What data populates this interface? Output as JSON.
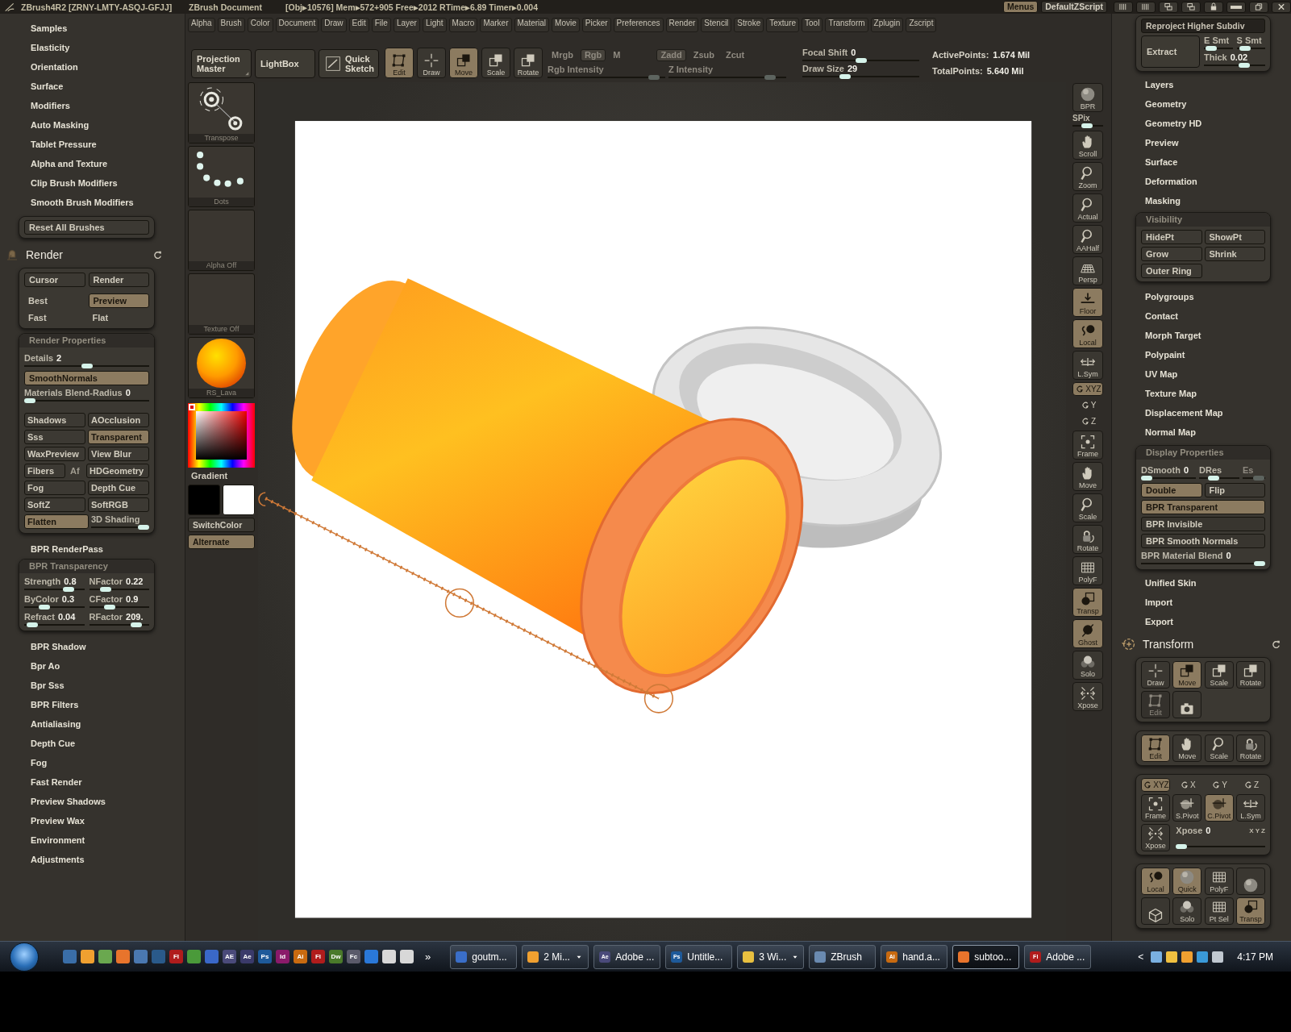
{
  "title_bar": {
    "app_title": "ZBrush4R2 [ZRNY-LMTY-ASQJ-GFJJ]",
    "document": "ZBrush Document",
    "stats": "[Obj▸10576] Mem▸572+905 Free▸2012 RTime▸6.89 Timer▸0.004",
    "buttons": [
      {
        "label": "Menus",
        "selected": true
      },
      {
        "label": "DefaultZScript",
        "selected": false
      }
    ]
  },
  "menu_bar": [
    "Alpha",
    "Brush",
    "Color",
    "Document",
    "Draw",
    "Edit",
    "File",
    "Layer",
    "Light",
    "Macro",
    "Marker",
    "Material",
    "Movie",
    "Picker",
    "Preferences",
    "Render",
    "Stencil",
    "Stroke",
    "Texture",
    "Tool",
    "Transform",
    "Zplugin",
    "Zscript"
  ],
  "top_toolbar": {
    "big_buttons": [
      "Projection Master",
      "LightBox",
      "Quick Sketch"
    ],
    "modes": [
      {
        "label": "Edit",
        "selected": true
      },
      {
        "label": "Draw",
        "selected": false
      },
      {
        "label": "Move",
        "selected": true
      },
      {
        "label": "Scale",
        "selected": false
      },
      {
        "label": "Rotate",
        "selected": false
      }
    ],
    "channels": {
      "disabled": true,
      "buttons": [
        {
          "label": "Mrgb",
          "selected": false
        },
        {
          "label": "Rgb",
          "selected": true
        },
        {
          "label": "M",
          "selected": false
        },
        {
          "label": "Zadd",
          "selected": true
        },
        {
          "label": "Zsub",
          "selected": false
        },
        {
          "label": "Zcut",
          "selected": false
        }
      ],
      "sliders": [
        {
          "label": "Rgb Intensity",
          "level": 0.95
        },
        {
          "label": "Z Intensity",
          "level": 0.9
        }
      ]
    },
    "sliders": [
      {
        "label": "Focal Shift",
        "value": "0",
        "level": 0.5
      },
      {
        "label": "Draw Size",
        "value": "29",
        "level": 0.35
      }
    ],
    "stats": [
      {
        "label": "ActivePoints:",
        "value": "1.674 Mil"
      },
      {
        "label": "TotalPoints:",
        "value": "5.640 Mil"
      }
    ]
  },
  "left_panel": {
    "menu_items_top": [
      "Samples",
      "Elasticity",
      "Orientation",
      "Surface",
      "Modifiers",
      "Auto Masking",
      "Tablet Pressure",
      "Alpha and Texture",
      "Clip Brush Modifiers",
      "Smooth Brush Modifiers"
    ],
    "reset_button": "Reset All Brushes",
    "section_title": "Render",
    "render_modes": [
      {
        "kind": "button",
        "label": "Cursor",
        "selected": false
      },
      {
        "kind": "button",
        "label": "Render",
        "selected": false
      },
      {
        "kind": "option",
        "label": "Best",
        "selected": false
      },
      {
        "kind": "option",
        "label": "Preview",
        "selected": true
      },
      {
        "kind": "option",
        "label": "Fast",
        "selected": false
      },
      {
        "kind": "option",
        "label": "Flat",
        "selected": false
      }
    ],
    "render_properties": {
      "title": "Render Properties",
      "rows": [
        {
          "kind": "slider",
          "label": "Details",
          "value": "2",
          "level": 0.5
        },
        {
          "kind": "toggle",
          "label": "SmoothNormals",
          "on": true
        },
        {
          "kind": "slider",
          "label": "Materials Blend-Radius",
          "value": "0",
          "level": 0
        }
      ],
      "toggle_rows": [
        [
          {
            "kind": "toggle",
            "label": "Shadows",
            "on": false,
            "disabled": false
          },
          {
            "kind": "toggle",
            "label": "AOcclusion",
            "on": false,
            "disabled": false
          }
        ],
        [
          {
            "kind": "toggle",
            "label": "Sss",
            "on": false,
            "disabled": false
          },
          {
            "kind": "toggle",
            "label": "Transparent",
            "on": true,
            "disabled": false
          }
        ],
        [
          {
            "kind": "toggle",
            "label": "WaxPreview",
            "on": false,
            "disabled": false
          },
          {
            "kind": "toggle",
            "label": "View Blur",
            "on": false,
            "disabled": false
          }
        ],
        [
          {
            "kind": "toggle",
            "label": "Fibers",
            "on": false,
            "disabled": false
          },
          {
            "kind": "toggle",
            "label": "Af",
            "on": false,
            "disabled": true
          },
          {
            "kind": "toggle",
            "label": "HDGeometry",
            "on": false,
            "disabled": false
          }
        ],
        [
          {
            "kind": "toggle",
            "label": "Fog",
            "on": false,
            "disabled": false
          },
          {
            "kind": "toggle",
            "label": "Depth Cue",
            "on": false,
            "disabled": false
          }
        ],
        [
          {
            "kind": "toggle",
            "label": "SoftZ",
            "on": false,
            "disabled": false
          },
          {
            "kind": "toggle",
            "label": "SoftRGB",
            "on": false,
            "disabled": false
          }
        ],
        [
          {
            "kind": "toggle",
            "label": "Flatten",
            "on": true,
            "disabled": false
          },
          {
            "kind": "slider",
            "label": "3D Shading",
            "level": 1
          }
        ]
      ]
    },
    "menu_items_middle": [
      "BPR RenderPass"
    ],
    "bpr_transparency": {
      "title": "BPR Transparency",
      "sliders": [
        {
          "label": "Strength",
          "value": "0.8",
          "level": 0.8
        },
        {
          "label": "NFactor",
          "value": "0.22",
          "level": 0.22
        },
        {
          "label": "ByColor",
          "value": "0.3",
          "level": 0.3
        },
        {
          "label": "CFactor",
          "value": "0.9",
          "level": 0.3
        },
        {
          "label": "Refract",
          "value": "0.04",
          "level": 0.05
        },
        {
          "label": "RFactor",
          "value": "209.",
          "level": 0.85
        }
      ]
    },
    "menu_items_bottom": [
      "BPR Shadow",
      "Bpr Ao",
      "Bpr Sss",
      "BPR Filters",
      "Antialiasing",
      "Depth Cue",
      "Fog",
      "Fast Render",
      "Preview Shadows",
      "Preview Wax",
      "Environment",
      "Adjustments"
    ]
  },
  "tool_column": {
    "thumbnails": [
      "Transpose",
      "Dots",
      "Alpha Off",
      "Texture Off",
      "RS_Lava"
    ],
    "gradient_label": "Gradient",
    "swatches": [
      {
        "color": "#000000"
      },
      {
        "color": "#ffffff"
      }
    ],
    "buttons": [
      {
        "label": "SwitchColor",
        "selected": false
      },
      {
        "label": "Alternate",
        "selected": true
      }
    ]
  },
  "right_toolbar": [
    {
      "kind": "button",
      "label": "BPR",
      "on": false
    },
    {
      "kind": "slider",
      "label": "SPix",
      "level": 0.45
    },
    {
      "kind": "button",
      "label": "Scroll",
      "on": false
    },
    {
      "kind": "button",
      "label": "Zoom",
      "on": false
    },
    {
      "kind": "button",
      "label": "Actual",
      "on": false
    },
    {
      "kind": "button",
      "label": "AAHalf",
      "on": false
    },
    {
      "kind": "button",
      "label": "Persp",
      "on": false
    },
    {
      "kind": "button",
      "label": "Floor",
      "on": true
    },
    {
      "kind": "button",
      "label": "Local",
      "on": true
    },
    {
      "kind": "button",
      "label": "L.Sym",
      "on": false
    },
    {
      "kind": "axis",
      "label": "XYZ",
      "on": true
    },
    {
      "kind": "axis",
      "label": "Y",
      "on": false
    },
    {
      "kind": "axis",
      "label": "Z",
      "on": false
    },
    {
      "kind": "button",
      "label": "Frame",
      "on": false
    },
    {
      "kind": "button",
      "label": "Move",
      "on": false
    },
    {
      "kind": "button",
      "label": "Scale",
      "on": false
    },
    {
      "kind": "button",
      "label": "Rotate",
      "on": false
    },
    {
      "kind": "button",
      "label": "PolyF",
      "on": false
    },
    {
      "kind": "button",
      "label": "Transp",
      "on": true
    },
    {
      "kind": "button",
      "label": "Ghost",
      "on": true
    },
    {
      "kind": "button",
      "label": "Solo",
      "on": false
    },
    {
      "kind": "button",
      "label": "Xpose",
      "on": false
    }
  ],
  "right_panel": {
    "top_button": {
      "label": "Reproject Higher Subdiv",
      "disabled": true
    },
    "extract_button": "Extract",
    "extract_sliders": [
      {
        "label": "E Smt",
        "level": 0.1
      },
      {
        "label": "S Smt",
        "level": 0.15
      },
      {
        "label": "Thick",
        "value": "0.02",
        "level": 0.7
      }
    ],
    "menu_items_a": [
      "Layers",
      "Geometry",
      "Geometry HD",
      "Preview",
      "Surface",
      "Deformation",
      "Masking"
    ],
    "visibility": {
      "title": "Visibility",
      "buttons": [
        "HidePt",
        "ShowPt",
        "Grow",
        "Shrink",
        "Outer Ring"
      ]
    },
    "menu_items_b": [
      "Polygroups",
      "Contact",
      "Morph Target",
      "Polypaint",
      "UV Map",
      "Texture Map",
      "Displacement Map",
      "Normal Map"
    ],
    "display_properties": {
      "title": "Display Properties",
      "sliders": [
        {
          "label": "DSmooth",
          "value": "0",
          "level": 0,
          "disabled": false
        },
        {
          "label": "DRes",
          "level": 0.3,
          "disabled": false
        },
        {
          "label": "Es",
          "level": 0.9,
          "disabled": true
        }
      ],
      "toggles": [
        {
          "label": "Double",
          "on": true
        },
        {
          "label": "Flip",
          "on": false
        }
      ],
      "rows": [
        {
          "kind": "toggle",
          "label": "BPR Transparent",
          "on": true
        },
        {
          "kind": "toggle",
          "label": "BPR Invisible",
          "on": false
        },
        {
          "kind": "toggle",
          "label": "BPR Smooth Normals",
          "on": false
        },
        {
          "kind": "slider",
          "label": "BPR Material Blend",
          "value": "0",
          "level": 1
        }
      ]
    },
    "menu_items_c": [
      "Unified Skin",
      "Import",
      "Export"
    ],
    "transform": {
      "title": "Transform",
      "modes": [
        {
          "label": "Draw",
          "selected": false,
          "disabled": false
        },
        {
          "label": "Move",
          "selected": true,
          "disabled": false
        },
        {
          "label": "Scale",
          "selected": false,
          "disabled": false
        },
        {
          "label": "Rotate",
          "selected": false,
          "disabled": false
        },
        {
          "label": "Edit",
          "selected": false,
          "disabled": true
        },
        {
          "selected": false,
          "disabled": false
        }
      ],
      "gizmo_modes": [
        {
          "label": "Edit",
          "selected": true
        },
        {
          "label": "Move",
          "selected": false
        },
        {
          "label": "Scale",
          "selected": false
        },
        {
          "label": "Rotate",
          "selected": false
        }
      ],
      "axes": [
        {
          "label": "XYZ",
          "on": true
        },
        {
          "label": "X",
          "on": false
        },
        {
          "label": "Y",
          "on": false
        },
        {
          "label": "Z",
          "on": false
        }
      ],
      "pivot_buttons": [
        {
          "label": "Frame",
          "disabled": false
        },
        {
          "label": "S.Pivot",
          "disabled": false
        },
        {
          "label": "C.Pivot",
          "disabled": true
        },
        {
          "label": "L.Sym",
          "disabled": false
        }
      ],
      "xpose_button": "Xpose",
      "xpose_slider": {
        "label": "Xpose",
        "value": "0",
        "level": 0
      },
      "axis_hint": "X Y Z",
      "display_buttons": [
        {
          "label": "Local",
          "on": true
        },
        {
          "label": "Quick",
          "on": true
        },
        {
          "label": "PolyF",
          "on": false
        },
        {
          "on": false
        },
        {
          "on": false
        },
        {
          "label": "Solo",
          "on": false
        },
        {
          "label": "Pt Sel",
          "on": false
        },
        {
          "label": "Transp",
          "on": true
        }
      ]
    }
  },
  "taskbar": {
    "quick_launch": [
      {
        "color": "#3a6ea8"
      },
      {
        "color": "#f0a030"
      },
      {
        "color": "#6aa84f"
      },
      {
        "color": "#e8742c"
      },
      {
        "color": "#4a78b0"
      },
      {
        "color": "#2a5a8a"
      },
      {
        "label": "Fl",
        "color": "#b01c1c"
      },
      {
        "color": "#4a9a3a"
      },
      {
        "color": "#3a68c8"
      },
      {
        "label": "AE",
        "color": "#4a4a7a"
      },
      {
        "label": "Ae",
        "color": "#3a3a6a"
      },
      {
        "label": "Ps",
        "color": "#1e5a9a"
      },
      {
        "label": "Id",
        "color": "#8a1a6a"
      },
      {
        "label": "Ai",
        "color": "#c86a10"
      },
      {
        "label": "Fl",
        "color": "#b01c1c"
      },
      {
        "label": "Dw",
        "color": "#4a7a2a"
      },
      {
        "label": "Fc",
        "color": "#5a5a6a"
      },
      {
        "color": "#2a78d8"
      },
      {
        "color": "#d8d8d8"
      },
      {
        "color": "#d8d8d8"
      }
    ],
    "overflow": "»",
    "tasks": [
      {
        "label": "goutm...",
        "color": "#3a6ec8",
        "selected": false,
        "grouped": false
      },
      {
        "label": "2 Mi...",
        "color": "#f0a030",
        "selected": false,
        "grouped": true
      },
      {
        "label": "Adobe ...",
        "icon_label": "Ae",
        "color": "#4a4a7a",
        "selected": false,
        "grouped": false
      },
      {
        "label": "Untitle...",
        "icon_label": "Ps",
        "color": "#1e5a9a",
        "selected": false,
        "grouped": false
      },
      {
        "label": "3 Wi...",
        "color": "#e8c040",
        "selected": false,
        "grouped": true
      },
      {
        "label": "ZBrush",
        "color": "#6a8ab0",
        "selected": false,
        "grouped": false
      },
      {
        "label": "hand.a...",
        "icon_label": "Ai",
        "color": "#c86a10",
        "selected": false,
        "grouped": false
      },
      {
        "label": "subtoo...",
        "color": "#e8742c",
        "selected": true,
        "grouped": false
      },
      {
        "label": "Adobe ...",
        "icon_label": "Fl",
        "color": "#b01c1c",
        "selected": false,
        "grouped": false
      }
    ],
    "tray_toggle": "<",
    "clock": "4:17 PM"
  }
}
